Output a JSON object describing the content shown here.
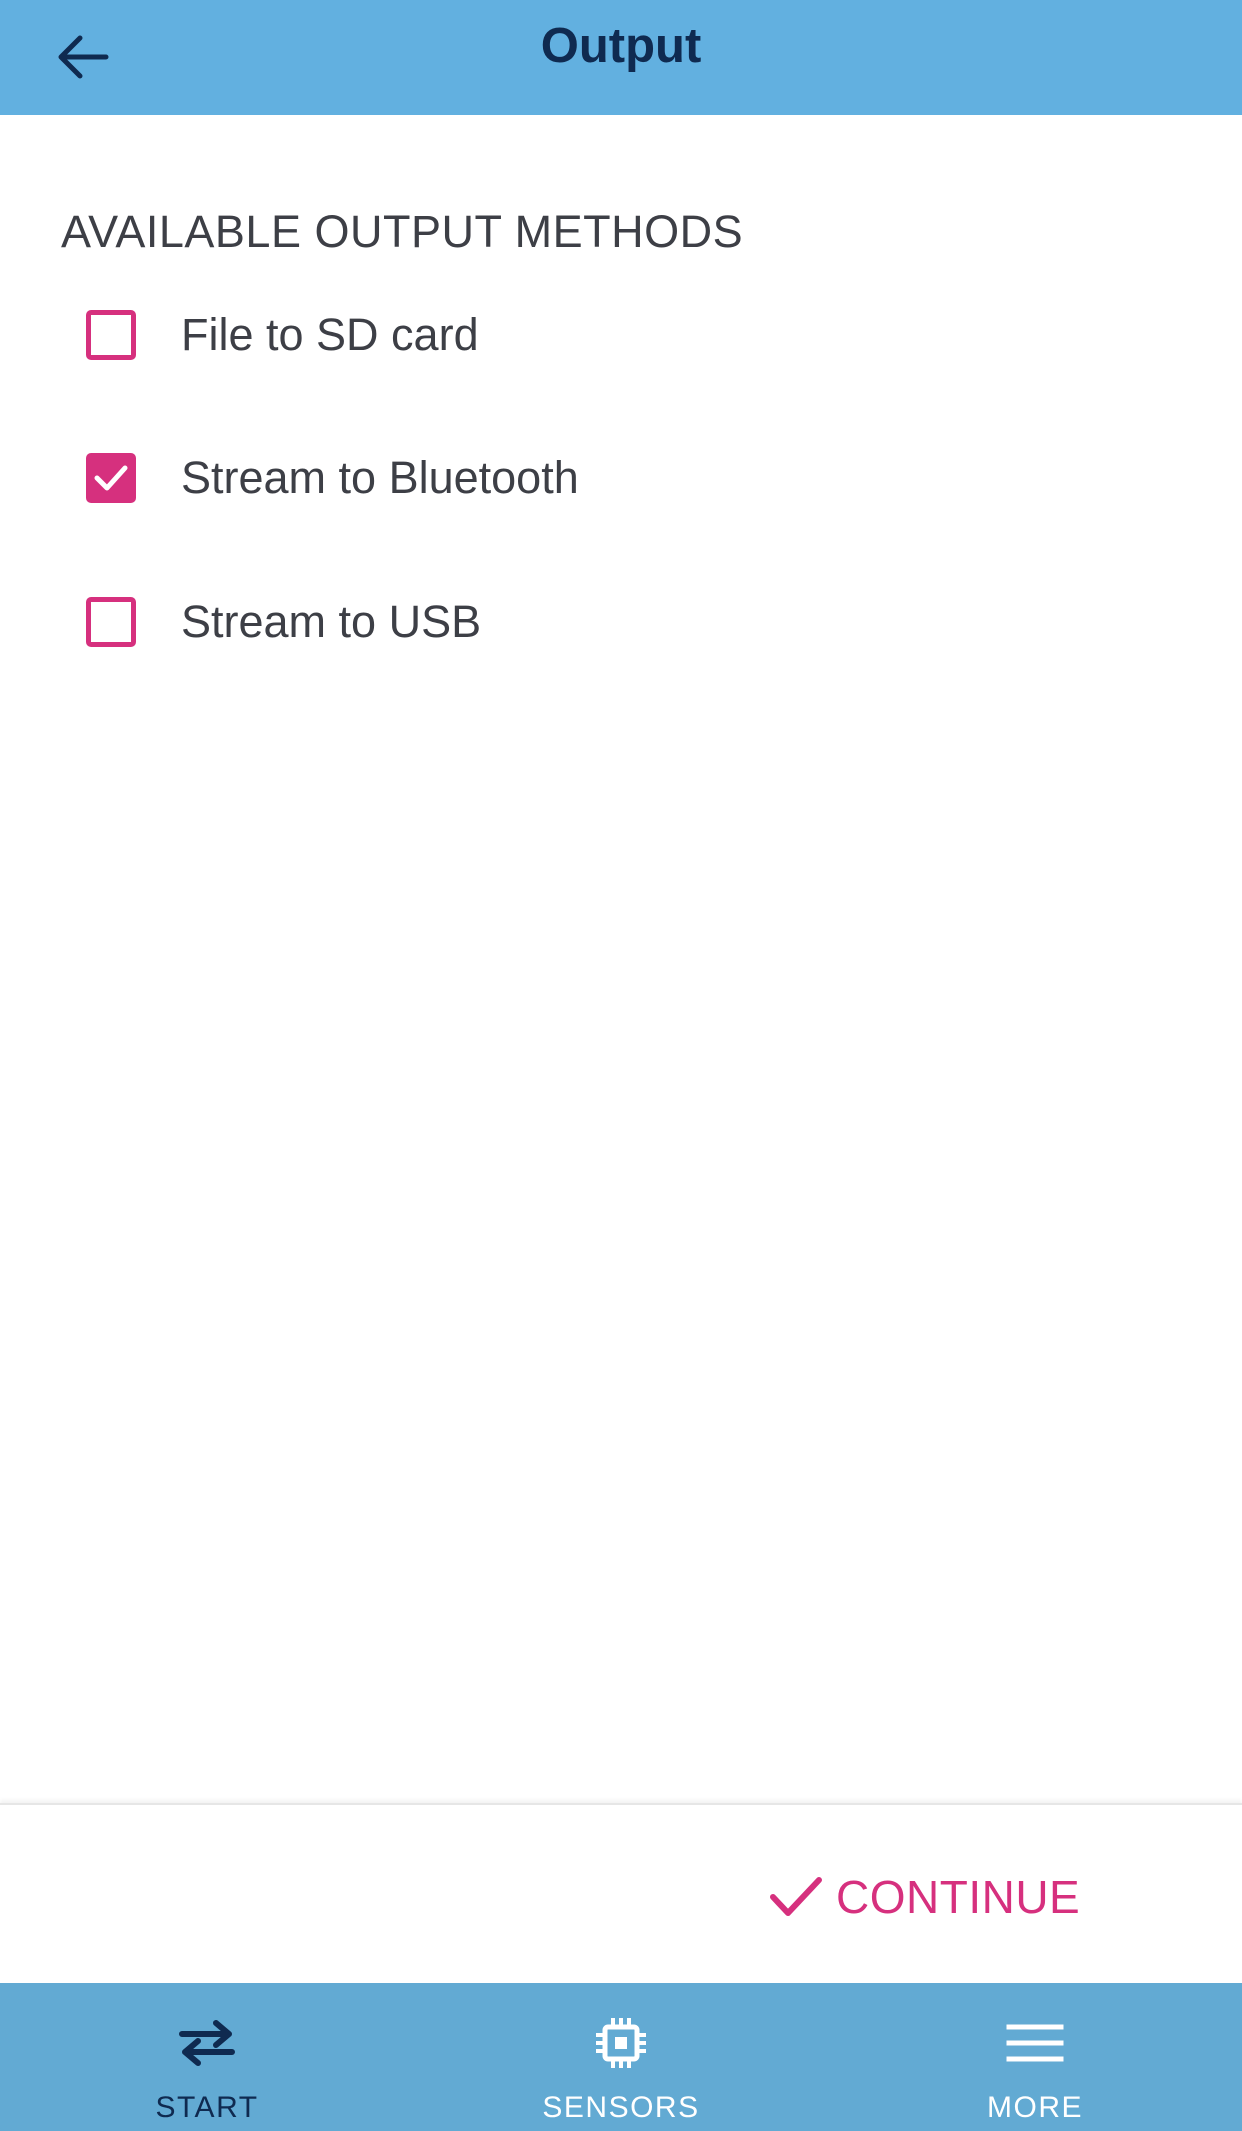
{
  "header": {
    "title": "Output",
    "back_icon": "arrow-left-icon"
  },
  "section": {
    "heading": "AVAILABLE OUTPUT METHODS",
    "options": [
      {
        "label": "File to SD card",
        "checked": false
      },
      {
        "label": "Stream to Bluetooth",
        "checked": true
      },
      {
        "label": "Stream to USB",
        "checked": false
      }
    ]
  },
  "action_bar": {
    "continue_label": "CONTINUE",
    "continue_icon": "check-icon"
  },
  "bottom_nav": {
    "items": [
      {
        "label": "START",
        "icon": "swap-arrows-icon",
        "active": true
      },
      {
        "label": "SENSORS",
        "icon": "chip-icon",
        "active": false
      },
      {
        "label": "MORE",
        "icon": "menu-icon",
        "active": false
      }
    ]
  },
  "colors": {
    "header_bg": "#62b0e0",
    "nav_bg": "#62aad3",
    "accent": "#d6307e",
    "title_text": "#0f2a50",
    "body_text": "#3d3f46"
  }
}
